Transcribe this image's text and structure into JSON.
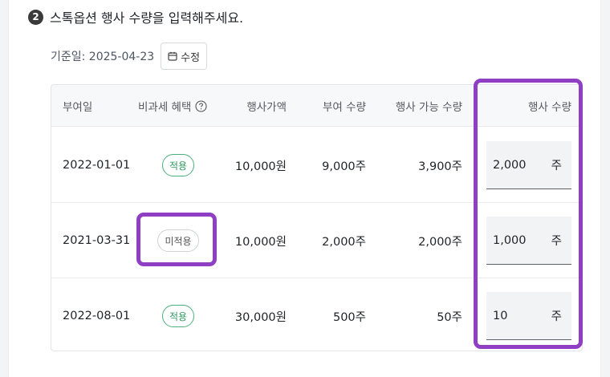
{
  "step": {
    "number": "2",
    "title": "스톡옵션 행사 수량을 입력해주세요."
  },
  "base_date": {
    "label": "기준일: 2025-04-23",
    "edit_label": "수정"
  },
  "table": {
    "headers": {
      "grant_date": "부여일",
      "tax_benefit": "비과세 혜택",
      "exercise_price": "행사가액",
      "grant_qty": "부여 수량",
      "exercisable_qty": "행사 가능 수량",
      "exercise_qty": "행사 수량"
    },
    "rows": [
      {
        "grant_date": "2022-01-01",
        "tax_benefit": "적용",
        "exercise_price": "10,000원",
        "grant_qty": "9,000주",
        "exercisable_qty": "3,900주",
        "exercise_qty": "2,000",
        "unit": "주"
      },
      {
        "grant_date": "2021-03-31",
        "tax_benefit": "미적용",
        "exercise_price": "10,000원",
        "grant_qty": "2,000주",
        "exercisable_qty": "2,000주",
        "exercise_qty": "1,000",
        "unit": "주"
      },
      {
        "grant_date": "2022-08-01",
        "tax_benefit": "적용",
        "exercise_price": "30,000원",
        "grant_qty": "500주",
        "exercisable_qty": "50주",
        "exercise_qty": "10",
        "unit": "주"
      }
    ]
  },
  "colors": {
    "highlight": "#8e3fc4",
    "applied_badge": "#2e9a5e",
    "not_applied_badge": "#555555"
  },
  "icons": {
    "step_badge": "circled-number-icon",
    "edit": "calendar-icon",
    "help": "question-circle-icon"
  }
}
